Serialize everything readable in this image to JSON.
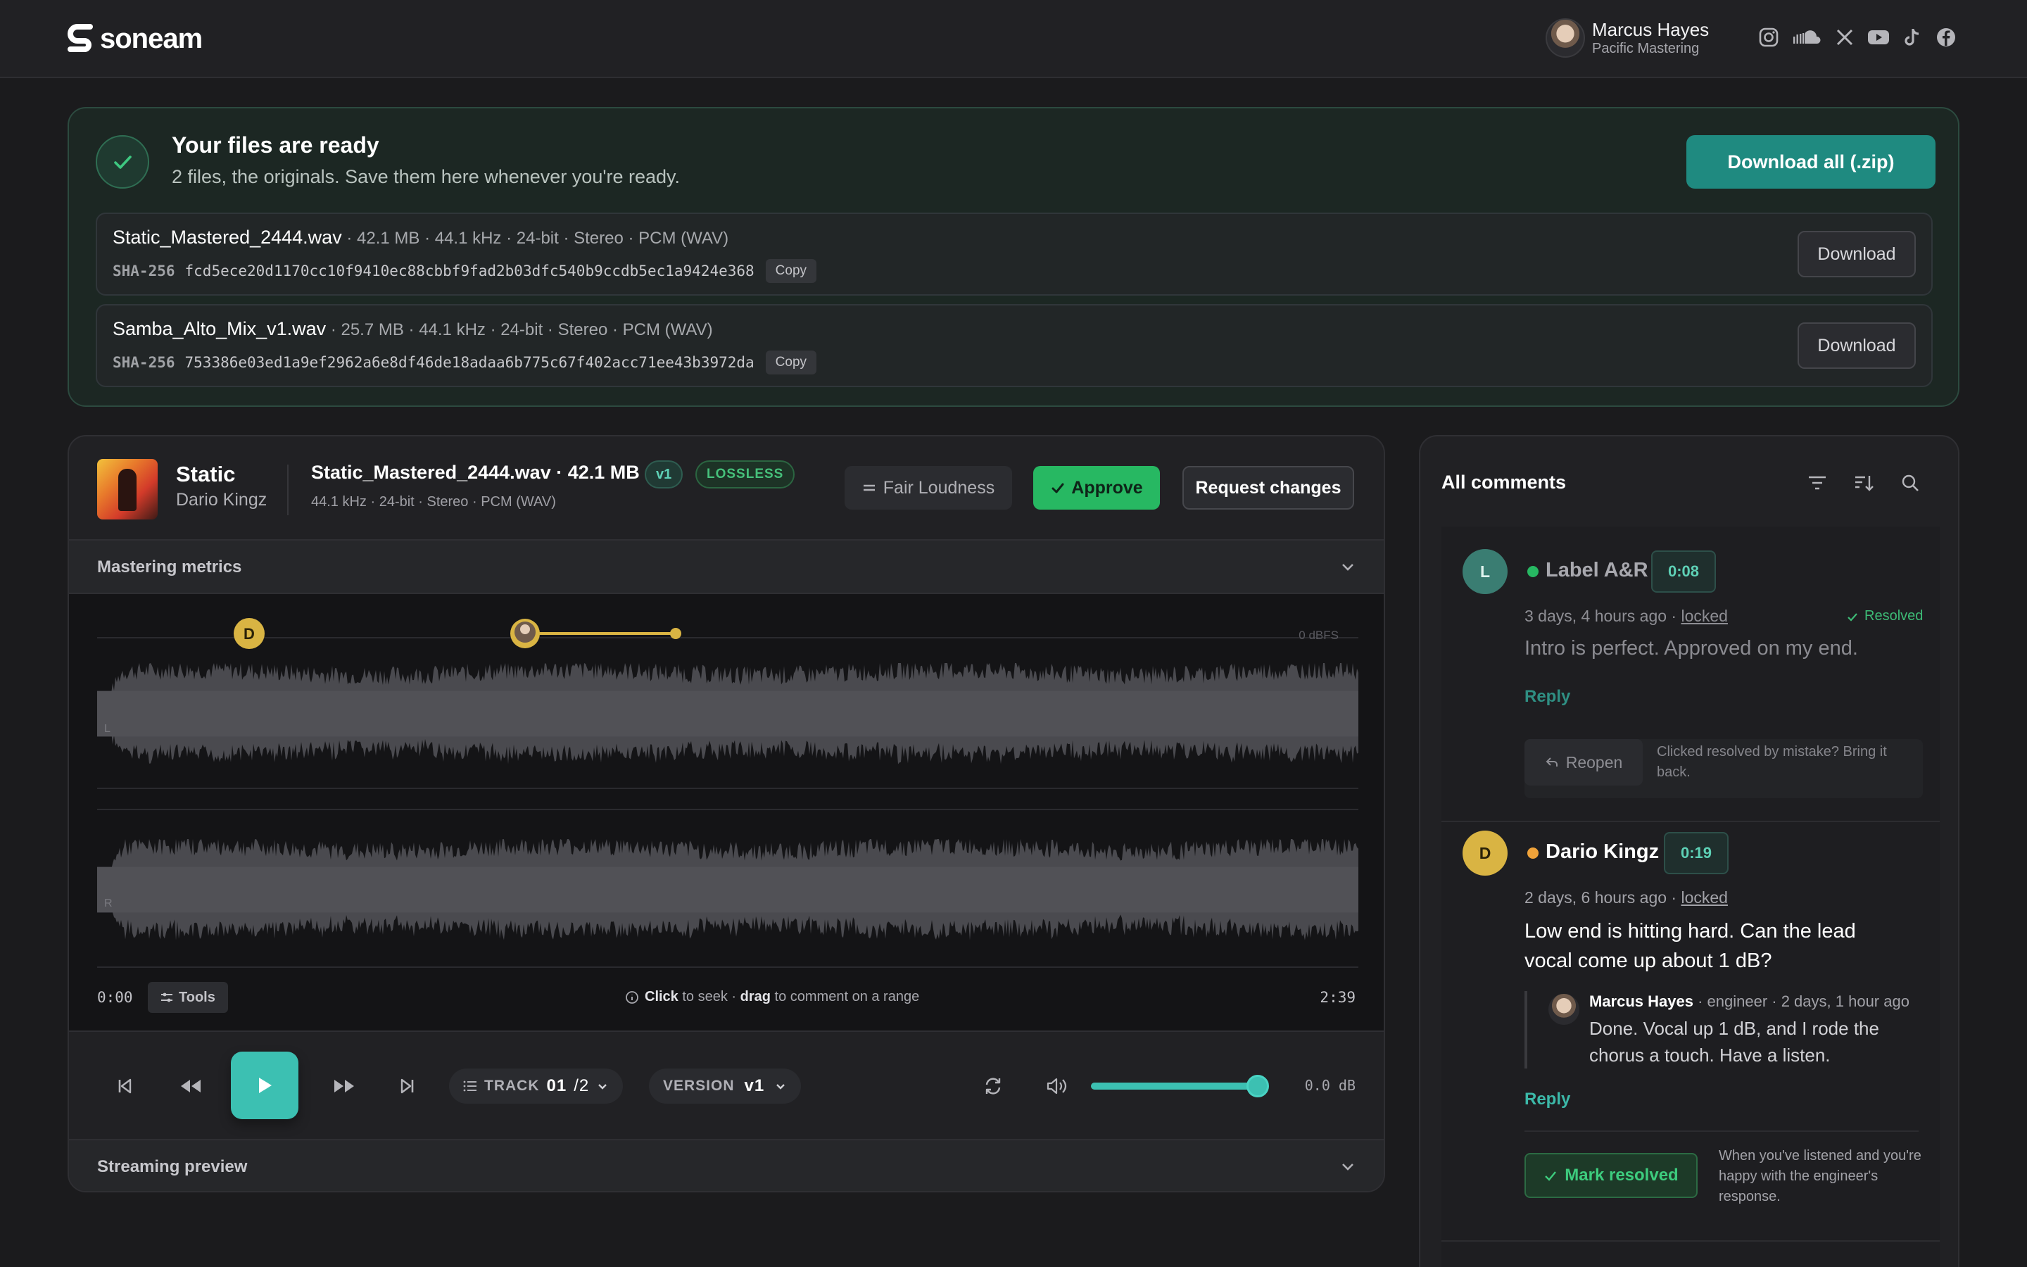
{
  "header": {
    "brand": "soneam",
    "user_name": "Marcus Hayes",
    "user_org": "Pacific Mastering",
    "socials": [
      "instagram-icon",
      "soundcloud-icon",
      "x-icon",
      "youtube-icon",
      "tiktok-icon",
      "facebook-icon"
    ]
  },
  "ready": {
    "title": "Your files are ready",
    "subtitle": "2 files, the originals. Save them here whenever you're ready.",
    "download_all": "Download all (.zip)",
    "files": [
      {
        "name": "Static_Mastered_2444.wav",
        "meta": " · 42.1 MB · 44.1 kHz · 24-bit · Stereo · PCM (WAV)",
        "hash_label": "SHA-256",
        "hash": "fcd5ece20d1170cc10f9410ec88cbbf9fad2b03dfc540b9ccdb5ec1a9424e368",
        "copy": "Copy",
        "download": "Download"
      },
      {
        "name": "Samba_Alto_Mix_v1.wav",
        "meta": " · 25.7 MB · 44.1 kHz · 24-bit · Stereo · PCM (WAV)",
        "hash_label": "SHA-256",
        "hash": "753386e03ed1a9ef2962a6e8df46de18adaa6b775c67f402acc71ee43b3972da",
        "copy": "Copy",
        "download": "Download"
      }
    ]
  },
  "player": {
    "title": "Static",
    "artist": "Dario Kingz",
    "file_title": "Static_Mastered_2444.wav · 42.1 MB",
    "file_meta": "44.1 kHz · 24-bit · Stereo · PCM (WAV)",
    "version_pill": "v1",
    "lossless": "LOSSLESS",
    "fair_loudness": "Fair Loudness",
    "approve": "Approve",
    "request_changes": "Request changes",
    "mastering_metrics": "Mastering metrics",
    "dbfs_label": "0 dBFS",
    "channel_left": "L",
    "channel_right": "R",
    "marker_initial": "D",
    "time_start": "0:00",
    "tools": "Tools",
    "hint_click": "Click",
    "hint_mid": " to seek · ",
    "hint_drag": "drag",
    "hint_end": " to comment on a range",
    "time_end": "2:39",
    "track_label": "TRACK",
    "track_num": "01",
    "track_total": "/2",
    "version_label": "VERSION",
    "version_value": "v1",
    "volume_level": 0.94,
    "db_readout": "0.0 dB",
    "streaming_preview": "Streaming preview"
  },
  "comments": {
    "title": "All comments",
    "items": [
      {
        "initial": "L",
        "name": "Label A&R",
        "timestamp": "0:08",
        "meta": "3 days, 4 hours ago · ",
        "locked": "locked",
        "resolved": "Resolved",
        "body": "Intro is perfect. Approved on my end.",
        "reply": "Reply",
        "reopen": "Reopen",
        "reopen_note": "Clicked resolved by mistake? Bring it back."
      },
      {
        "initial": "D",
        "name": "Dario Kingz",
        "timestamp": "0:19",
        "meta": "2 days, 6 hours ago · ",
        "locked": "locked",
        "body": "Low end is hitting hard. Can the lead vocal come up about 1 dB?",
        "reply_author": "Marcus Hayes",
        "reply_meta": " · engineer · 2 days, 1 hour ago",
        "reply_body": "Done. Vocal up 1 dB, and I rode the chorus a touch. Have a listen.",
        "reply": "Reply",
        "mark_resolved": "Mark resolved",
        "mark_note": "When you've listened and you're happy with the engineer's response."
      }
    ]
  },
  "colors": {
    "accent_teal": "#3cc0b2",
    "approve_green": "#27b862",
    "marker_yellow": "#d9b443",
    "label_ar_teal": "#3a7d72"
  }
}
